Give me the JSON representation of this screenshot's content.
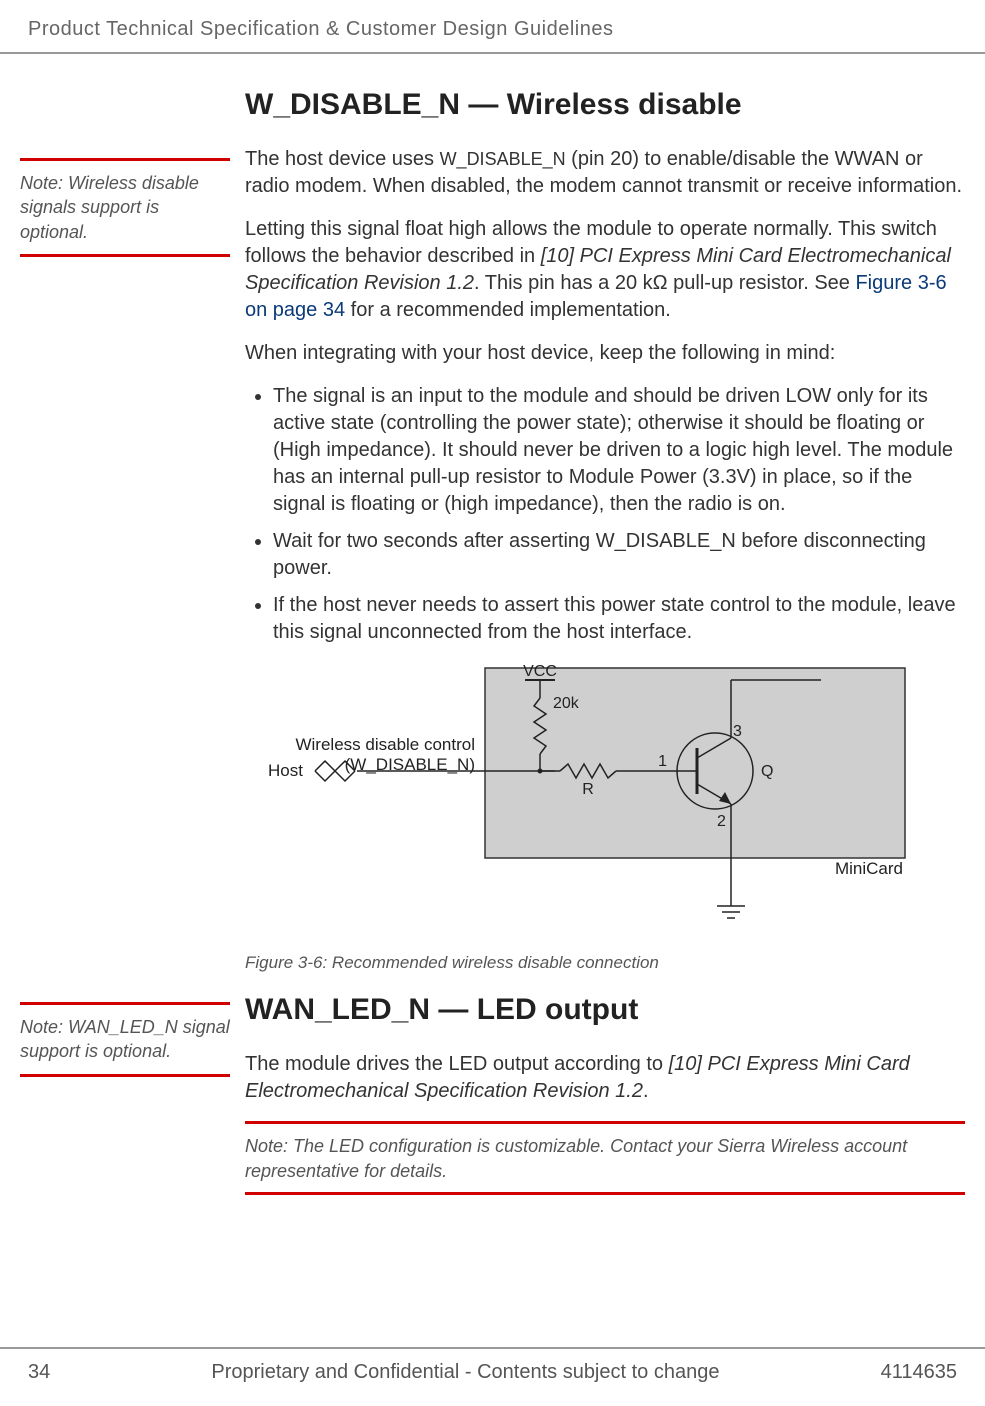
{
  "header": {
    "running": "Product Technical Specification & Customer Design Guidelines"
  },
  "sec1": {
    "title": "W_DISABLE_N — Wireless disable",
    "sidenote": "Note:  Wireless disable signals support is optional.",
    "p1a": "The host device uses ",
    "p1b": "W_DISABLE_N",
    "p1c": " (pin 20) to enable/disable the WWAN or radio modem. When disabled, the modem cannot transmit or receive information.",
    "p2a": "Letting this signal float high allows the module to operate normally. This switch follows the behavior described in ",
    "p2b": "[10] PCI Express Mini Card Electromechanical Specification Revision 1.2",
    "p2c": ". This pin has a 20 kΩ pull-up resistor. See ",
    "p2d": "Figure 3-6 on page 34",
    "p2e": " for a recommended implementation.",
    "p3": "When integrating with your host device, keep the following in mind:",
    "li1": "The signal is an input to the module and should be driven LOW only for its active state (controlling the power state); otherwise it should be floating or (High impedance). It should never be driven to a logic high level. The module has an internal pull-up resistor to Module Power (3.3V) in place, so if the signal is floating or (high impedance), then the radio is on.",
    "li2": "Wait for two seconds after asserting W_DISABLE_N before disconnecting power.",
    "li3": "If the host never needs to assert this power state control to the module, leave this signal unconnected from the host interface."
  },
  "fig": {
    "host": "Host",
    "ctrl1": "Wireless disable control",
    "ctrl2": "(W_DISABLE_N)",
    "vcc": "VCC",
    "r20k": "20k",
    "r": "R",
    "q": "Q",
    "n1": "1",
    "n2": "2",
    "n3": "3",
    "minicard": "MiniCard",
    "caption": "Figure 3-6:  Recommended wireless disable connection"
  },
  "sec2": {
    "title": "WAN_LED_N — LED output",
    "sidenote": "Note:  WAN_LED_N signal support is optional.",
    "p1a": "The module drives the LED output according to ",
    "p1b": "[10] PCI Express Mini Card Electromechanical Specification Revision 1.2",
    "p1c": ".",
    "note": "Note:  The LED configuration is customizable. Contact your Sierra Wireless account representative for details."
  },
  "footer": {
    "page": "34",
    "center": "Proprietary and Confidential - Contents subject to change",
    "docnum": "4114635"
  }
}
